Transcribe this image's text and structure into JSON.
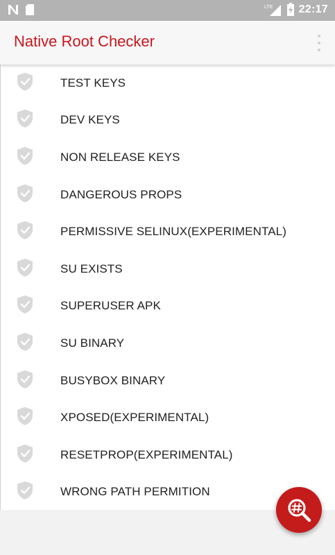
{
  "status_bar": {
    "time": "22:17",
    "left_icons": [
      "n-notification-icon",
      "sd-card-icon"
    ],
    "right_icons": [
      "lte-signal-icon",
      "battery-icon"
    ]
  },
  "app_bar": {
    "title": "Native Root Checker",
    "title_color": "#c8161d",
    "menu_icon": "overflow-menu-icon"
  },
  "checks": [
    {
      "label": "TEST KEYS",
      "icon": "shield-check-icon"
    },
    {
      "label": "DEV KEYS",
      "icon": "shield-check-icon"
    },
    {
      "label": "NON RELEASE KEYS",
      "icon": "shield-check-icon"
    },
    {
      "label": "DANGEROUS PROPS",
      "icon": "shield-check-icon"
    },
    {
      "label": "PERMISSIVE SELINUX(EXPERIMENTAL)",
      "icon": "shield-check-icon"
    },
    {
      "label": "SU EXISTS",
      "icon": "shield-check-icon"
    },
    {
      "label": "SUPERUSER APK",
      "icon": "shield-check-icon"
    },
    {
      "label": "SU BINARY",
      "icon": "shield-check-icon"
    },
    {
      "label": "BUSYBOX BINARY",
      "icon": "shield-check-icon"
    },
    {
      "label": "XPOSED(EXPERIMENTAL)",
      "icon": "shield-check-icon"
    },
    {
      "label": "RESETPROP(EXPERIMENTAL)",
      "icon": "shield-check-icon"
    },
    {
      "label": "WRONG PATH PERMITION",
      "icon": "shield-check-icon"
    }
  ],
  "fab": {
    "icon": "hash-search-icon",
    "color": "#c41b1b"
  }
}
